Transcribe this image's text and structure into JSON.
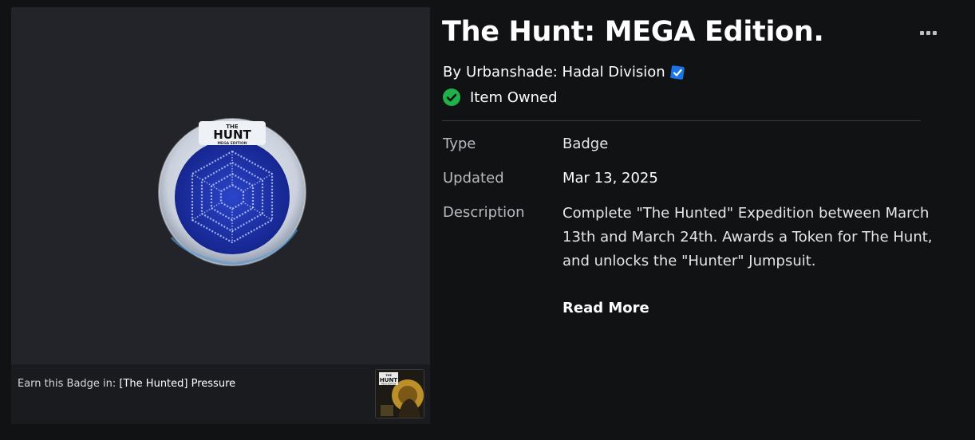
{
  "item": {
    "title": "The Hunt: MEGA Edition.",
    "by_prefix": "By",
    "creator": "Urbanshade: Hadal Division",
    "owned_status": "Item Owned"
  },
  "badge_image": {
    "logo_title": "THE",
    "logo_main": "HUNT",
    "logo_sub": "MEGA EDITION"
  },
  "earn": {
    "prefix": "Earn this Badge in:",
    "game_name": "[The Hunted] Pressure",
    "thumb_title": "THE",
    "thumb_main": "HUNT",
    "thumb_sub": "MEGA EDITION"
  },
  "details": {
    "type_label": "Type",
    "type_value": "Badge",
    "updated_label": "Updated",
    "updated_value": "Mar 13, 2025",
    "description_label": "Description",
    "description_value": "Complete \"The Hunted\" Expedition between March 13th and March 24th. Awards a Token for The Hunt, and unlocks the \"Hunter\" Jumpsuit."
  },
  "actions": {
    "read_more": "Read More"
  },
  "icons": {
    "more": "more-options-icon",
    "verified": "verified-badge-icon",
    "owned": "check-circle-icon"
  },
  "colors": {
    "background": "#111214",
    "card": "#232429",
    "owned_green": "#1fb24a",
    "verified_blue": "#1a75e8",
    "badge_blue": "#1b2fa3"
  }
}
